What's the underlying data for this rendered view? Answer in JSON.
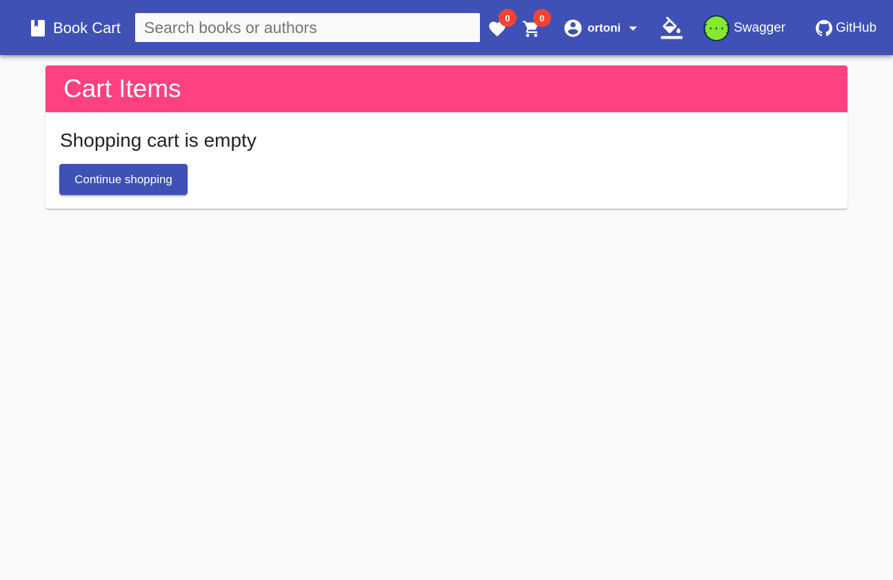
{
  "toolbar": {
    "brand_label": "Book Cart",
    "brand_icon": "book-icon",
    "search_placeholder": "Search books or authors",
    "wishlist_count": "0",
    "cart_count": "0",
    "user_name": "ortoni",
    "swagger_label": "Swagger",
    "github_label": "GitHub"
  },
  "card": {
    "title": "Cart Items",
    "empty_message": "Shopping cart is empty",
    "continue_label": "Continue shopping"
  },
  "colors": {
    "primary": "#3f51b5",
    "accent": "#ff4081",
    "badge": "#f44336",
    "swagger_green": "#85ea2d",
    "background": "#fafafa"
  }
}
